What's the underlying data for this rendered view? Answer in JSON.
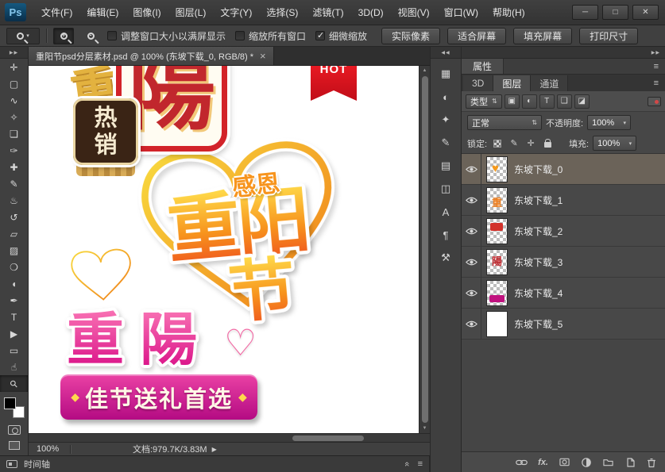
{
  "app": {
    "logo": "Ps"
  },
  "window_controls": {
    "minimize": "─",
    "maximize": "□",
    "close": "✕"
  },
  "menu_bar": {
    "items": [
      "文件(F)",
      "编辑(E)",
      "图像(I)",
      "图层(L)",
      "文字(Y)",
      "选择(S)",
      "滤镜(T)",
      "3D(D)",
      "视图(V)",
      "窗口(W)",
      "帮助(H)"
    ]
  },
  "options_bar": {
    "checkboxes": [
      {
        "label": "调整窗口大小以满屏显示",
        "checked": false
      },
      {
        "label": "缩放所有窗口",
        "checked": false
      },
      {
        "label": "细微缩放",
        "checked": true
      }
    ],
    "buttons": [
      "实际像素",
      "适合屏幕",
      "填充屏幕",
      "打印尺寸"
    ]
  },
  "document_tab": {
    "title": "重阳节psd分层素材.psd @ 100% (东坡下载_0, RGB/8) *",
    "close_label": "×"
  },
  "glyphs": {
    "caret": "▾",
    "updown": "⇅",
    "scroll_up": "▲",
    "scroll_down": "▼"
  },
  "tools": [
    {
      "name": "move-tool",
      "glyph": "✛",
      "selected": false
    },
    {
      "name": "rectangular-marquee-tool",
      "glyph": "▢",
      "selected": false
    },
    {
      "name": "lasso-tool",
      "glyph": "∿",
      "selected": false
    },
    {
      "name": "quick-selection-tool",
      "glyph": "✧",
      "selected": false
    },
    {
      "name": "crop-tool",
      "glyph": "❏",
      "selected": false
    },
    {
      "name": "eyedropper-tool",
      "glyph": "✑",
      "selected": false
    },
    {
      "name": "healing-brush-tool",
      "glyph": "✚",
      "selected": false
    },
    {
      "name": "brush-tool",
      "glyph": "✎",
      "selected": false
    },
    {
      "name": "clone-stamp-tool",
      "glyph": "♨",
      "selected": false
    },
    {
      "name": "history-brush-tool",
      "glyph": "↺",
      "selected": false
    },
    {
      "name": "eraser-tool",
      "glyph": "▱",
      "selected": false
    },
    {
      "name": "gradient-tool",
      "glyph": "▨",
      "selected": false
    },
    {
      "name": "blur-tool",
      "glyph": "❍",
      "selected": false
    },
    {
      "name": "dodge-tool",
      "glyph": "◖",
      "selected": false
    },
    {
      "name": "pen-tool",
      "glyph": "✒",
      "selected": false
    },
    {
      "name": "type-tool",
      "glyph": "T",
      "selected": false
    },
    {
      "name": "path-selection-tool",
      "glyph": "▶",
      "selected": false
    },
    {
      "name": "shape-tool",
      "glyph": "▭",
      "selected": false
    },
    {
      "name": "hand-tool",
      "glyph": "☝",
      "selected": false
    },
    {
      "name": "zoom-tool",
      "glyph": "⚲",
      "selected": true
    }
  ],
  "icon_dock": [
    {
      "name": "swatches-panel-icon",
      "glyph": "▦"
    },
    {
      "name": "adjustments-panel-icon",
      "glyph": "◐"
    },
    {
      "name": "styles-panel-icon",
      "glyph": "✦"
    },
    {
      "name": "brush-panel-icon",
      "glyph": "✎"
    },
    {
      "name": "brush-presets-panel-icon",
      "glyph": "▤"
    },
    {
      "name": "clone-source-panel-icon",
      "glyph": "◫"
    },
    {
      "name": "character-panel-icon",
      "glyph": "A"
    },
    {
      "name": "paragraph-panel-icon",
      "glyph": "¶"
    },
    {
      "name": "tool-presets-panel-icon",
      "glyph": "⚒"
    }
  ],
  "panels": {
    "tools_dock_collapse": "▶▶",
    "dock_collapse_left": "◀◀",
    "dock_collapse_right": "▶▶",
    "properties": {
      "title": "属性",
      "menu_icon": "≡"
    },
    "layers_group": {
      "tabs": [
        "3D",
        "图层",
        "通道"
      ],
      "active_tab": "图层",
      "menu_icon": "≡"
    },
    "filter": {
      "label": "类型",
      "icons": [
        {
          "name": "filter-pixel-layers-icon",
          "glyph": "▣"
        },
        {
          "name": "filter-adjustment-layers-icon",
          "glyph": "◐"
        },
        {
          "name": "filter-type-layers-icon",
          "glyph": "T"
        },
        {
          "name": "filter-shape-layers-icon",
          "glyph": "❑"
        },
        {
          "name": "filter-smart-objects-icon",
          "glyph": "◪"
        }
      ]
    },
    "blend": {
      "mode": "正常",
      "opacity_label": "不透明度:",
      "opacity_value": "100%"
    },
    "lock": {
      "label": "锁定:",
      "icon_paint": "✎",
      "icon_move": "✛",
      "fill_label": "填充:",
      "fill_value": "100%"
    },
    "footer_fx": "fx.",
    "layers": [
      {
        "name": "东坡下载_0",
        "selected": true
      },
      {
        "name": "东坡下载_1",
        "selected": false
      },
      {
        "name": "东坡下载_2",
        "selected": false
      },
      {
        "name": "东坡下载_3",
        "selected": false
      },
      {
        "name": "东坡下载_4",
        "selected": false
      },
      {
        "name": "东坡下载_5",
        "selected": false
      }
    ]
  },
  "canvas_art": {
    "hot_ribbon": "HOT",
    "gold_fragment": "重",
    "stamp_char": "陽",
    "badge_chars": [
      "热",
      "销"
    ],
    "thanks": "感恩",
    "title_main": "重阳",
    "title_sub": "节",
    "pink_title": "重陽",
    "pink_heart": "♡",
    "banner_diamond": "◆",
    "banner_text": "佳节送礼首选",
    "colors": {
      "red": "#d2232a",
      "brown": "#3a2415",
      "orange": "#f7941d",
      "magenta": "#d8128a",
      "gold": "#e2aa3c"
    }
  },
  "status_bar": {
    "zoom": "100%",
    "doc_info": "文档:979.7K/3.83M",
    "arrow": "▶"
  },
  "timeline": {
    "title": "时间轴",
    "collapse_icon": "«",
    "menu_icon": "≡"
  }
}
